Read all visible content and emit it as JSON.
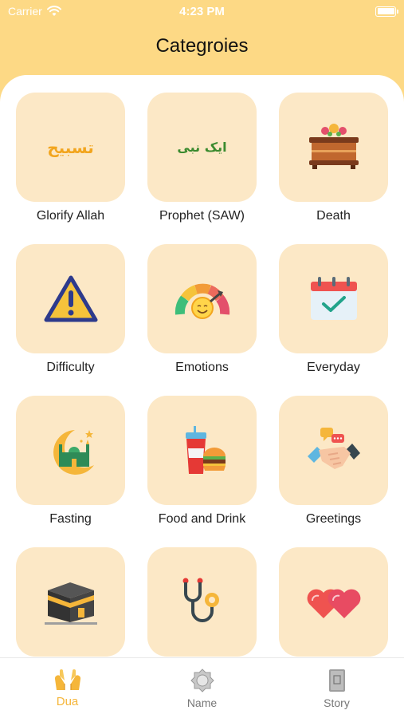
{
  "status_bar": {
    "carrier": "Carrier",
    "time": "4:23 PM"
  },
  "nav": {
    "title": "Categroies"
  },
  "categories": [
    {
      "label": "Glorify Allah",
      "icon": "tasbih-text-icon",
      "icon_text": "تسبیح",
      "icon_text_color": "#F2A51E"
    },
    {
      "label": "Prophet (SAW)",
      "icon": "ek-nabi-text-icon",
      "icon_text": "ایک نبی",
      "icon_text_color": "#3A8A2E"
    },
    {
      "label": "Death",
      "icon": "coffin-icon"
    },
    {
      "label": "Difficulty",
      "icon": "warning-icon"
    },
    {
      "label": "Emotions",
      "icon": "mood-meter-icon"
    },
    {
      "label": "Everyday",
      "icon": "calendar-check-icon"
    },
    {
      "label": "Fasting",
      "icon": "crescent-mosque-icon"
    },
    {
      "label": "Food and Drink",
      "icon": "drink-burger-icon"
    },
    {
      "label": "Greetings",
      "icon": "handshake-icon"
    },
    {
      "label": "",
      "icon": "kaaba-icon"
    },
    {
      "label": "",
      "icon": "stethoscope-icon"
    },
    {
      "label": "",
      "icon": "hearts-icon"
    }
  ],
  "tabs": [
    {
      "label": "Dua",
      "icon": "praying-hands-icon",
      "active": true
    },
    {
      "label": "Name",
      "icon": "name-medallion-icon",
      "active": false
    },
    {
      "label": "Story",
      "icon": "quran-book-icon",
      "active": false
    }
  ],
  "colors": {
    "header_bg": "#FDD985",
    "tile_bg": "#FCE8C6",
    "accent": "#F5B63A"
  }
}
